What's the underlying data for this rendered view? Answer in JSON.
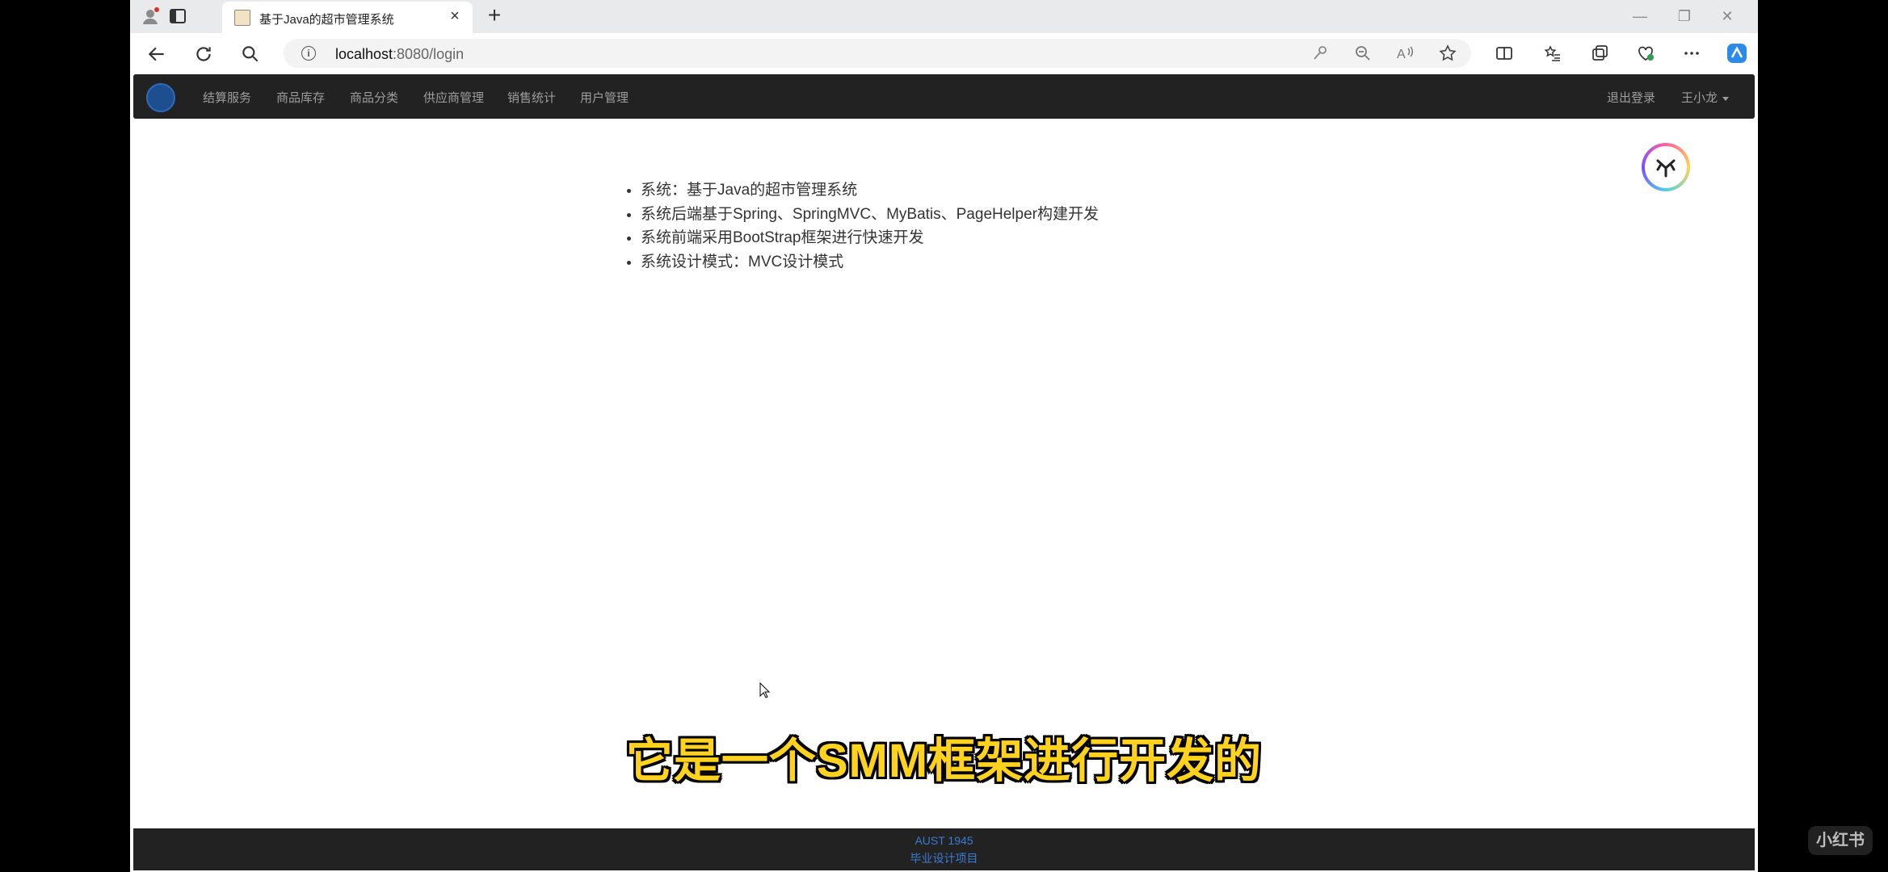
{
  "browser": {
    "tab_title": "基于Java的超市管理系统",
    "url_host": "localhost",
    "url_rest": ":8080/login"
  },
  "navbar": {
    "items": [
      "结算服务",
      "商品库存",
      "商品分类",
      "供应商管理",
      "销售统计",
      "用户管理"
    ],
    "logout": "退出登录",
    "user": "王小龙"
  },
  "features": [
    "系统：基于Java的超市管理系统",
    "系统后端基于Spring、SpringMVC、MyBatis、PageHelper构建开发",
    "系统前端采用BootStrap框架进行快速开发",
    "系统设计模式：MVC设计模式"
  ],
  "footer": {
    "line1": "AUST 1945",
    "line2": "毕业设计项目"
  },
  "subtitle": "它是一个SMM框架进行开发的",
  "watermark": "小红书",
  "colors": {
    "navbar_bg": "#222222",
    "nav_text": "#9d9d9d",
    "footer_text": "#3b7bd1",
    "subtitle": "#ffd21e"
  }
}
